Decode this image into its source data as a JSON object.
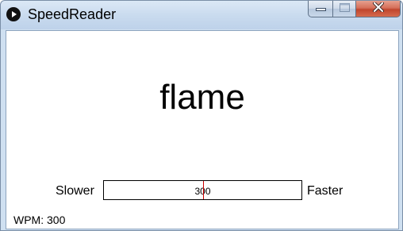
{
  "window": {
    "title": "SpeedReader"
  },
  "reader": {
    "current_word": "flame"
  },
  "speed_slider": {
    "slower_label": "Slower",
    "faster_label": "Faster",
    "value": "300",
    "min": 0,
    "max": 600,
    "fraction": 0.5
  },
  "status": {
    "wpm_text": "WPM: 300"
  },
  "colors": {
    "thumb": "#cc0000",
    "close_button": "#c0452d"
  },
  "icons": {
    "app": "play-circle-icon",
    "minimize": "minimize-icon",
    "maximize": "maximize-icon",
    "close": "close-icon"
  }
}
